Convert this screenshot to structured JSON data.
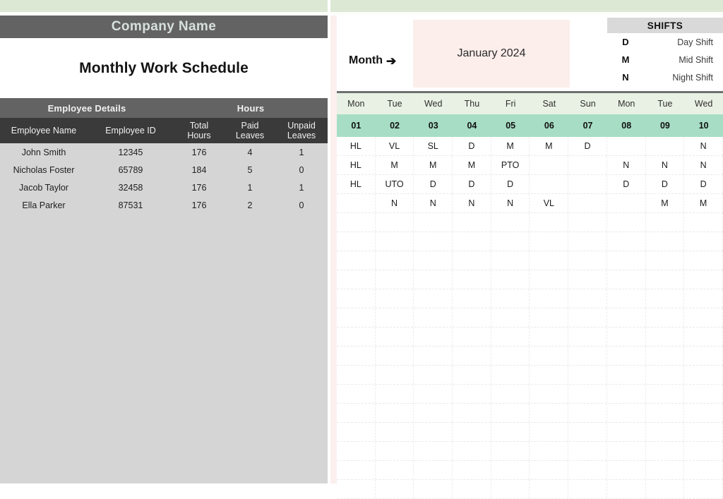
{
  "left_panel": {
    "company_name": "Company Name",
    "title": "Monthly Work Schedule",
    "group_headers": {
      "employee_details": "Employee Details",
      "hours": "Hours"
    },
    "columns": [
      "Employee Name",
      "Employee ID",
      "Total Hours",
      "Paid Leaves",
      "Unpaid Leaves"
    ],
    "column_lines": {
      "total_hours_a": "Total",
      "total_hours_b": "Hours",
      "paid_a": "Paid",
      "paid_b": "Leaves",
      "unpaid_a": "Unpaid",
      "unpaid_b": "Leaves"
    },
    "employees": [
      {
        "name": "John Smith",
        "id": "12345",
        "total_hours": "176",
        "paid_leaves": "4",
        "unpaid_leaves": "1"
      },
      {
        "name": "Nicholas Foster",
        "id": "65789",
        "total_hours": "184",
        "paid_leaves": "5",
        "unpaid_leaves": "0"
      },
      {
        "name": "Jacob Taylor",
        "id": "32458",
        "total_hours": "176",
        "paid_leaves": "1",
        "unpaid_leaves": "1"
      },
      {
        "name": "Ella Parker",
        "id": "87531",
        "total_hours": "176",
        "paid_leaves": "2",
        "unpaid_leaves": "0"
      }
    ]
  },
  "right_panel": {
    "month_label": "Month",
    "month_arrow_icon": "➔",
    "month_value": "January 2024",
    "shifts": {
      "title": "SHIFTS",
      "legend": [
        {
          "code": "D",
          "label": "Day Shift"
        },
        {
          "code": "M",
          "label": "Mid Shift"
        },
        {
          "code": "N",
          "label": "Night Shift"
        }
      ]
    },
    "calendar": {
      "weekdays": [
        "Mon",
        "Tue",
        "Wed",
        "Thu",
        "Fri",
        "Sat",
        "Sun",
        "Mon",
        "Tue",
        "Wed"
      ],
      "dates": [
        "01",
        "02",
        "03",
        "04",
        "05",
        "06",
        "07",
        "08",
        "09",
        "10"
      ],
      "schedule_rows": [
        [
          "HL",
          "VL",
          "SL",
          "D",
          "M",
          "M",
          "D",
          "",
          "",
          "N"
        ],
        [
          "HL",
          "M",
          "M",
          "M",
          "PTO",
          "",
          "",
          "N",
          "N",
          "N"
        ],
        [
          "HL",
          "UTO",
          "D",
          "D",
          "D",
          "",
          "",
          "D",
          "D",
          "D"
        ],
        [
          "",
          "N",
          "N",
          "N",
          "N",
          "VL",
          "",
          "",
          "M",
          "M"
        ]
      ],
      "empty_rows": 15
    }
  },
  "colors": {
    "top_band_green": "#dce8d4",
    "header_gray": "#636363",
    "column_header_gray": "#3a3a3a",
    "left_body_gray": "#d5d5d5",
    "month_box_pink": "#fbeeeb",
    "shifts_header_gray": "#d9d9d9",
    "weekday_green": "#e9f1e4",
    "date_green": "#a7ddc5"
  }
}
